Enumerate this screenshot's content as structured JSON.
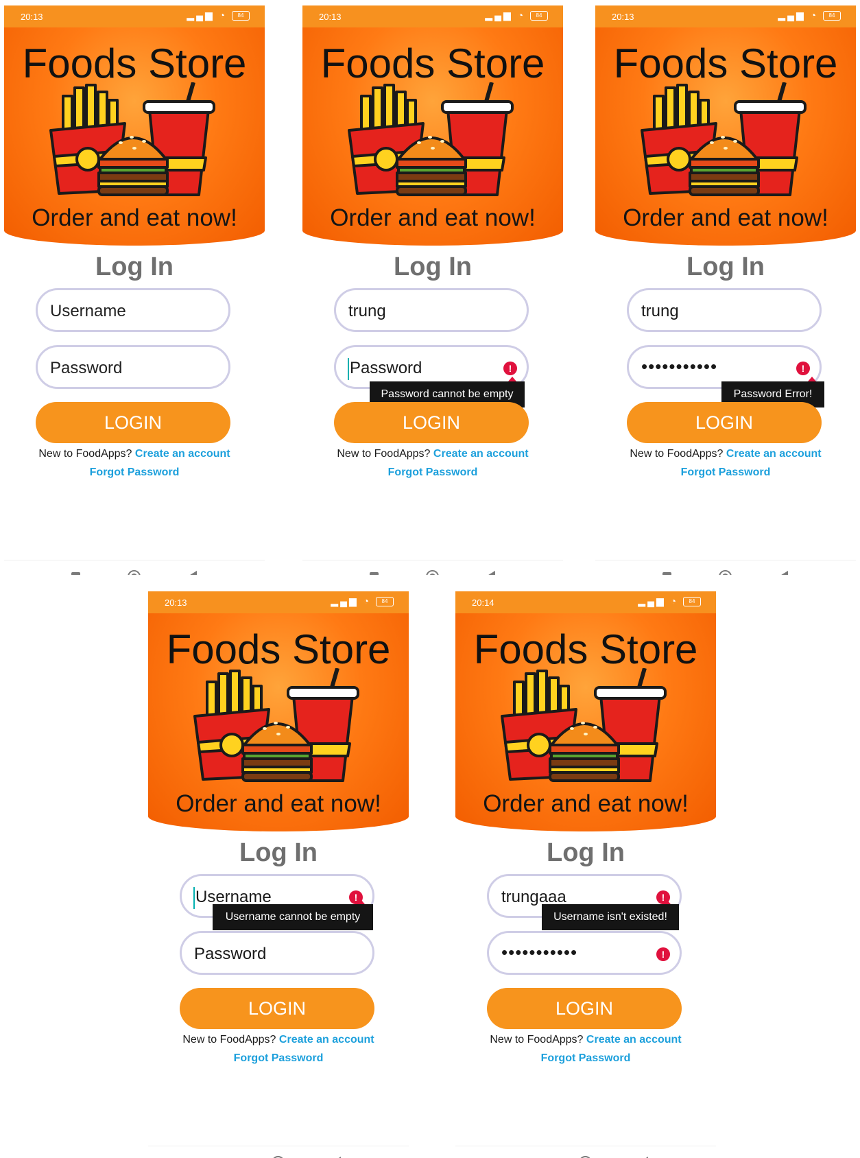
{
  "common": {
    "app_title": "Foods Store",
    "tagline": "Order and eat now!",
    "login_heading": "Log In",
    "login_button": "LOGIN",
    "signup_prompt": "New to FoodApps?",
    "signup_link": "Create an account",
    "forgot_link": "Forgot Password",
    "battery": "84"
  },
  "screens": [
    {
      "time": "20:13",
      "username": "Username",
      "password": "Password"
    },
    {
      "time": "20:13",
      "username": "trung",
      "password": "Password",
      "tooltip": "Password cannot be empty"
    },
    {
      "time": "20:13",
      "username": "trung",
      "password": "•••••••••••",
      "tooltip": "Password Error!"
    },
    {
      "time": "20:13",
      "username": "Username",
      "password": "Password",
      "tooltip": "Username cannot be empty"
    },
    {
      "time": "20:14",
      "username": "trungaaa",
      "password": "•••••••••••",
      "tooltip": "Username isn't existed!"
    }
  ]
}
